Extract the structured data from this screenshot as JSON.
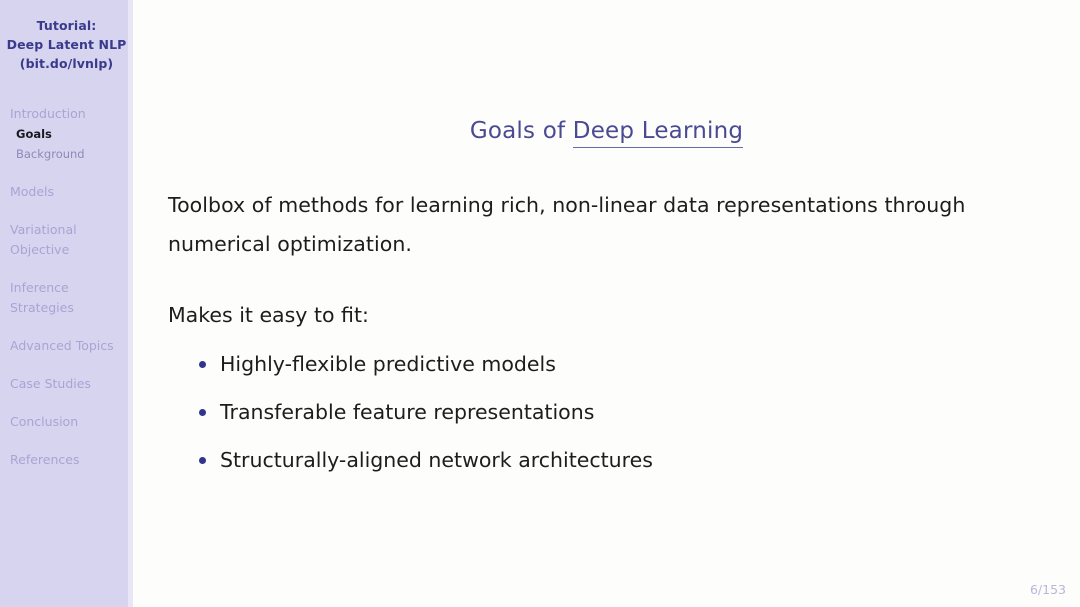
{
  "sidebar": {
    "title_lines": [
      "Tutorial:",
      "Deep Latent NLP",
      "(bit.do/lvnlp)"
    ],
    "nav": [
      {
        "label": "Introduction",
        "type": "section"
      },
      {
        "label": "Goals",
        "type": "sub",
        "active": true
      },
      {
        "label": "Background",
        "type": "sub",
        "active": false
      },
      {
        "label": "Models",
        "type": "section"
      },
      {
        "label": "Variational Objective",
        "type": "section"
      },
      {
        "label": "Inference Strategies",
        "type": "section"
      },
      {
        "label": "Advanced Topics",
        "type": "section"
      },
      {
        "label": "Case Studies",
        "type": "section"
      },
      {
        "label": "Conclusion",
        "type": "section"
      },
      {
        "label": "References",
        "type": "section"
      }
    ]
  },
  "slide": {
    "title_plain": "Goals of ",
    "title_underlined": "Deep Learning",
    "lead_paragraph": "Toolbox of methods for learning rich, non-linear data representations through numerical optimization.",
    "makes_line": "Makes it easy to fit:",
    "bullets": [
      "Highly-flexible predictive models",
      "Transferable feature representations",
      "Structurally-aligned network architectures"
    ],
    "page_number": "6/153"
  },
  "colors": {
    "sidebar_bg": "#d7d4f0",
    "sidebar_title": "#3a3a8c",
    "nav_inactive": "#a8a4d4",
    "nav_active": "#18181f",
    "title": "#4a4a93",
    "bullet_dot": "#32328f",
    "body_text": "#1d1d1d",
    "page_number": "#b9b6d8",
    "slide_bg": "#fdfdfc"
  }
}
